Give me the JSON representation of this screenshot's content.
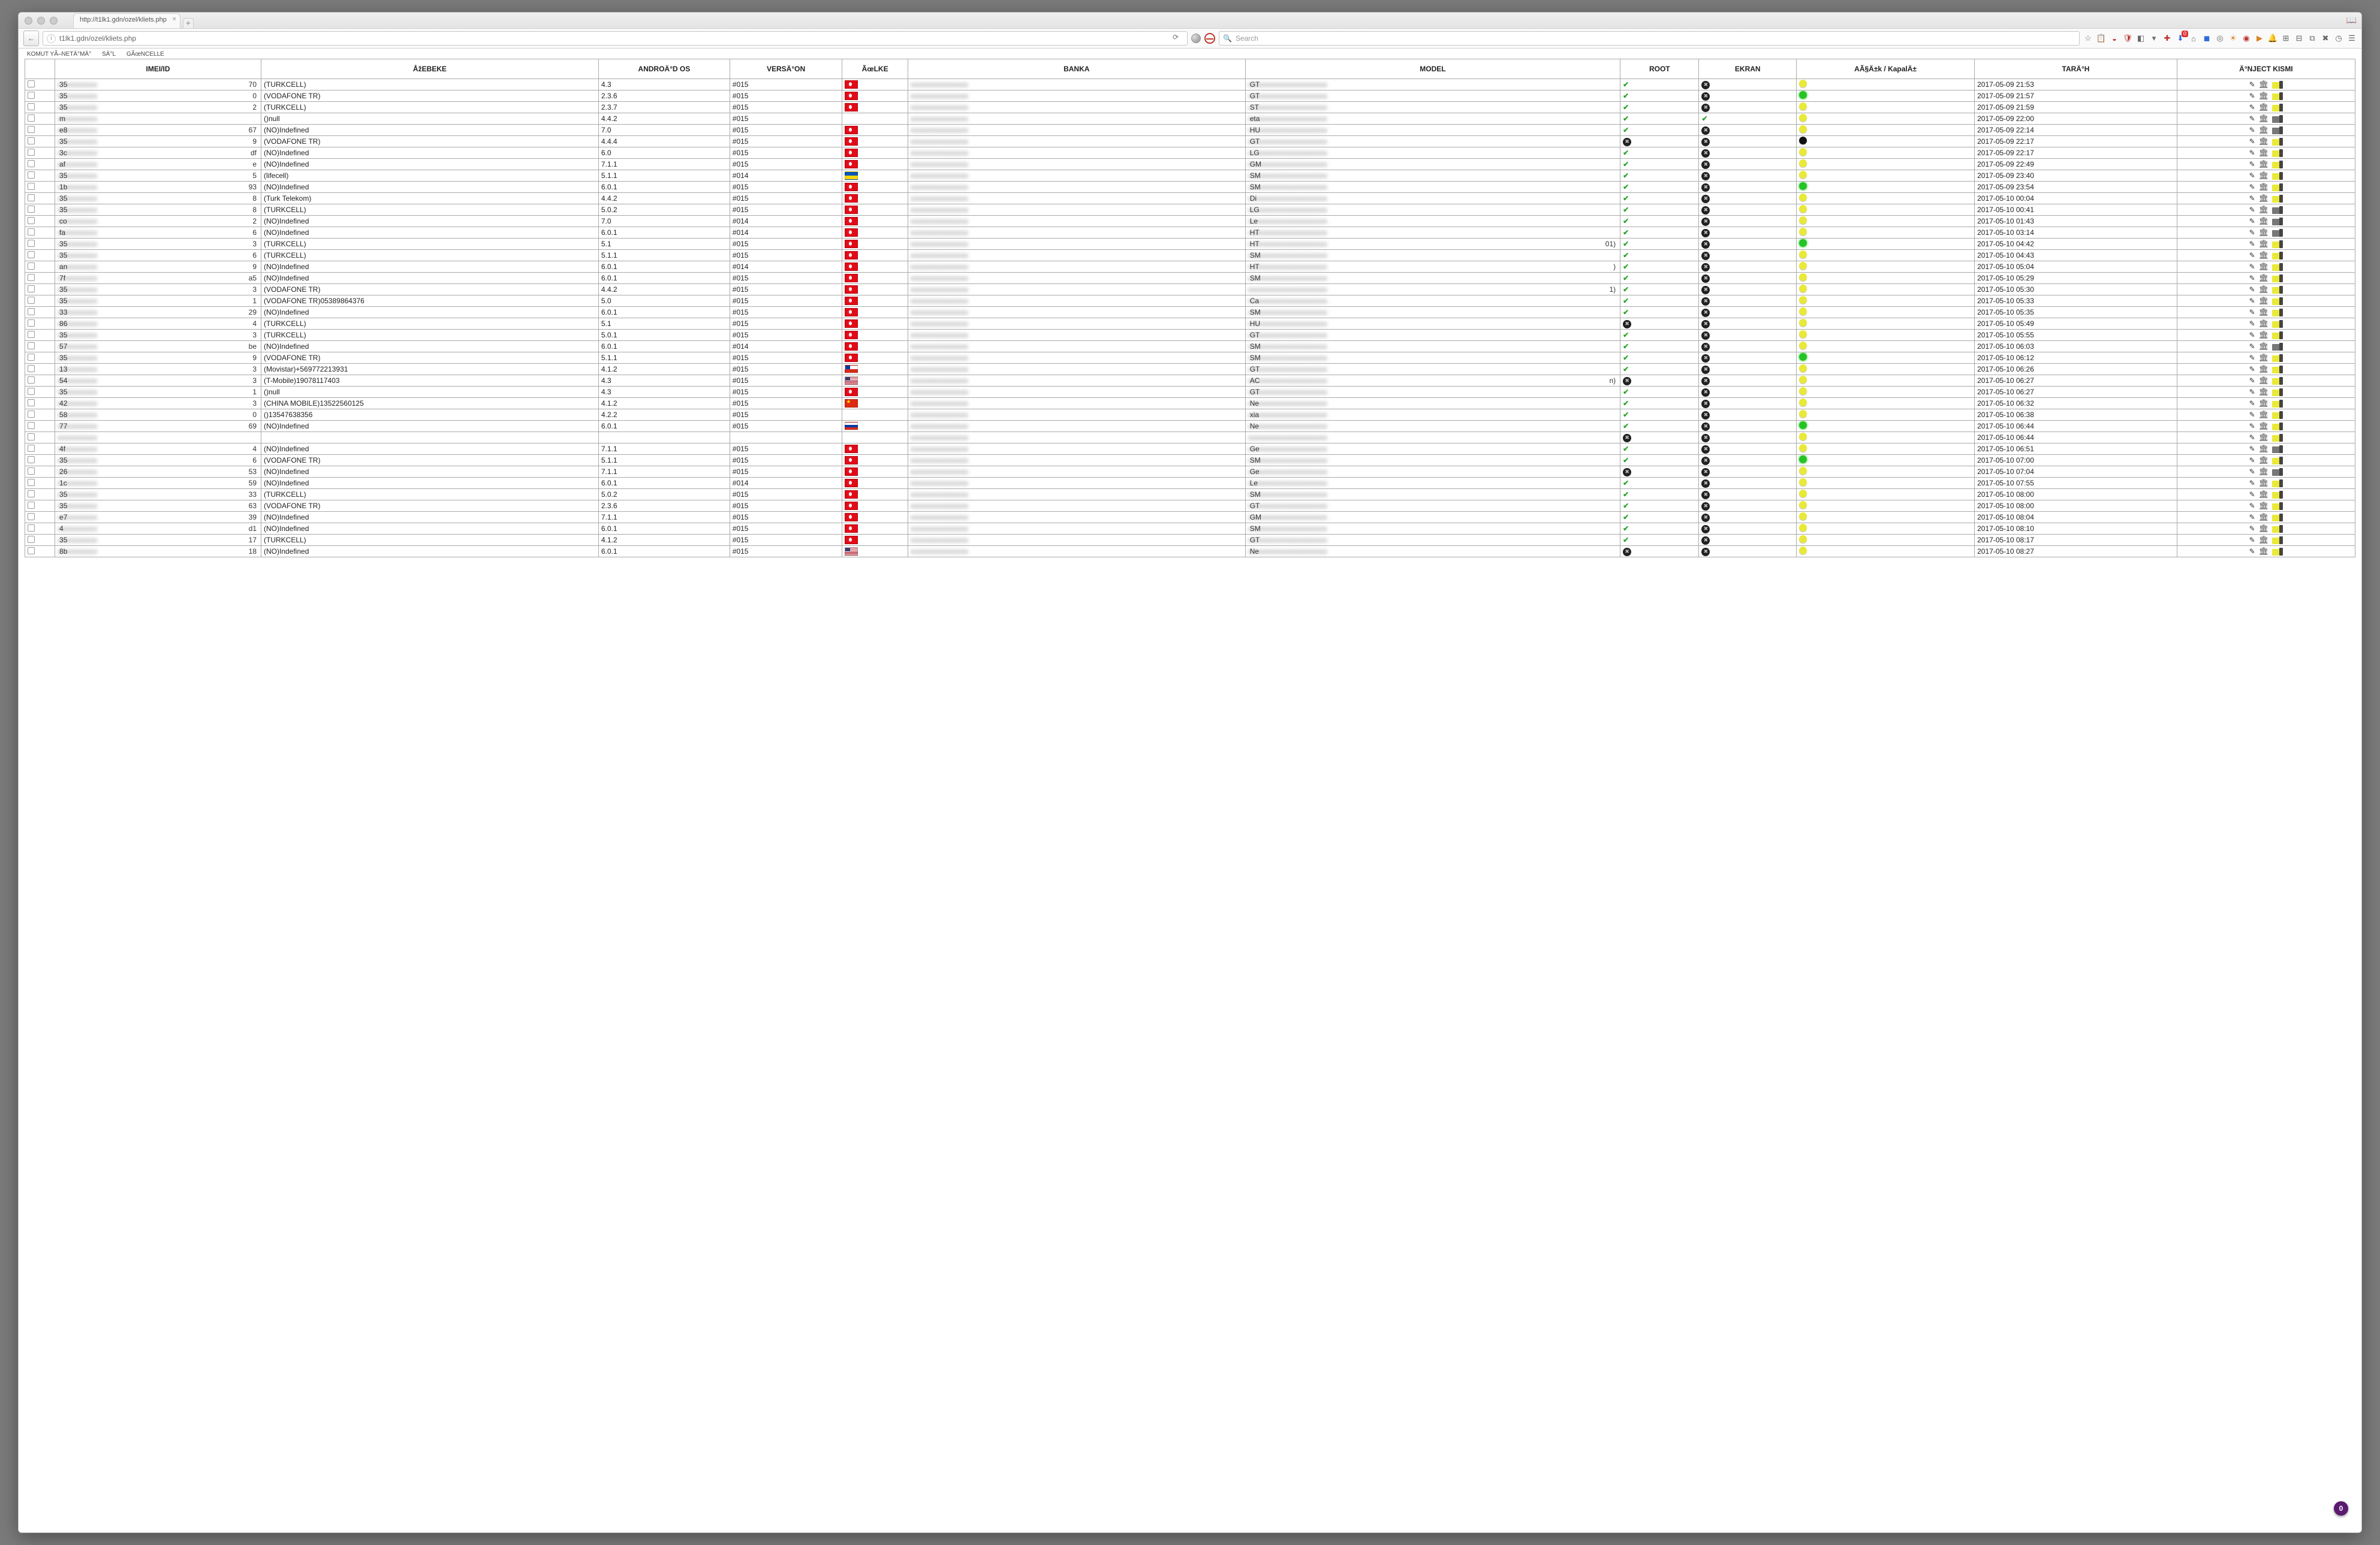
{
  "window": {
    "tab_title": "http://t1lk1.gdn/ozel/kliets.php",
    "sidebar_icon": "📖"
  },
  "toolbar": {
    "url": "t1lk1.gdn/ozel/kliets.php",
    "search_placeholder": "Search"
  },
  "page_menu": [
    "KOMUT YÃ–NETÄ°MÄ°",
    "SÄ°L",
    "GÃœNCELLE"
  ],
  "headers": {
    "imei": "IMEI/ID",
    "sebeke": "ÅžEBEKE",
    "android": "ANDROÄ°D OS",
    "version": "VERSÄ°ON",
    "ulke": "ÃœLKE",
    "banka": "BANKA",
    "model": "MODEL",
    "root": "ROOT",
    "ekran": "EKRAN",
    "acik": "AÃ§Ä±k / KapalÄ±",
    "tarih": "TARÄ°H",
    "inject": "Ä°NJECT KISMI"
  },
  "rows": [
    {
      "pre": "35",
      "suf": "70",
      "sebeke": "(TURKCELL)",
      "and": "4.3",
      "ver": "#015",
      "flag": "tr",
      "mpre": "GT",
      "root": "tick",
      "ekran": "x",
      "dot": "yel",
      "tarih": "2017-05-09 21:53",
      "fold": "yel"
    },
    {
      "pre": "35",
      "suf": "0",
      "sebeke": "(VODAFONE TR)",
      "and": "2.3.6",
      "ver": "#015",
      "flag": "tr",
      "mpre": "GT",
      "root": "tick",
      "ekran": "x",
      "dot": "grn",
      "tarih": "2017-05-09 21:57",
      "fold": "yel"
    },
    {
      "pre": "35",
      "suf": "2",
      "sebeke": "(TURKCELL)",
      "and": "2.3.7",
      "ver": "#015",
      "flag": "tr",
      "mpre": "ST",
      "root": "tick",
      "ekran": "x",
      "dot": "yel",
      "tarih": "2017-05-09 21:59",
      "fold": "yel"
    },
    {
      "pre": "m",
      "suf": "",
      "sebeke": "()null",
      "and": "4.4.2",
      "ver": "#015",
      "flag": "none",
      "mpre": "eta",
      "root": "tick",
      "ekran": "tick",
      "dot": "yel",
      "tarih": "2017-05-09 22:00",
      "fold": "gry"
    },
    {
      "pre": "e8",
      "suf": "67",
      "sebeke": "(NO)Indefined",
      "and": "7.0",
      "ver": "#015",
      "flag": "tr",
      "mpre": "HU",
      "root": "tick",
      "ekran": "x",
      "dot": "yel",
      "tarih": "2017-05-09 22:14",
      "fold": "gry"
    },
    {
      "pre": "35",
      "suf": "9",
      "sebeke": "(VODAFONE TR)",
      "and": "4.4.4",
      "ver": "#015",
      "flag": "tr",
      "mpre": "GT",
      "root": "x",
      "ekran": "x",
      "dot": "blk",
      "tarih": "2017-05-09 22:17",
      "fold": "yel"
    },
    {
      "pre": "3c",
      "suf": "df",
      "sebeke": "(NO)Indefined",
      "and": "6.0",
      "ver": "#015",
      "flag": "tr",
      "mpre": "LG",
      "root": "tick",
      "ekran": "x",
      "dot": "yel",
      "tarih": "2017-05-09 22:17",
      "fold": "yel"
    },
    {
      "pre": "af",
      "suf": "e",
      "sebeke": "(NO)Indefined",
      "and": "7.1.1",
      "ver": "#015",
      "flag": "tr",
      "mpre": "GM",
      "root": "tick",
      "ekran": "x",
      "dot": "yel",
      "tarih": "2017-05-09 22:49",
      "fold": "yel"
    },
    {
      "pre": "35",
      "suf": "5",
      "sebeke": "(lifecell)",
      "and": "5.1.1",
      "ver": "#014",
      "flag": "ua",
      "mpre": "SM",
      "root": "tick",
      "ekran": "x",
      "dot": "yel",
      "tarih": "2017-05-09 23:40",
      "fold": "yel"
    },
    {
      "pre": "1b",
      "suf": "93",
      "sebeke": "(NO)Indefined",
      "and": "6.0.1",
      "ver": "#015",
      "flag": "tr",
      "mpre": "SM",
      "root": "tick",
      "ekran": "x",
      "dot": "grn",
      "tarih": "2017-05-09 23:54",
      "fold": "yel"
    },
    {
      "pre": "35",
      "suf": "8",
      "sebeke": "(Turk Telekom)",
      "and": "4.4.2",
      "ver": "#015",
      "flag": "tr",
      "mpre": "Di",
      "root": "tick",
      "ekran": "x",
      "dot": "yel",
      "tarih": "2017-05-10 00:04",
      "fold": "yel"
    },
    {
      "pre": "35",
      "suf": "8",
      "sebeke": "(TURKCELL)",
      "and": "5.0.2",
      "ver": "#015",
      "flag": "tr",
      "mpre": "LG",
      "root": "tick",
      "ekran": "x",
      "dot": "yel",
      "tarih": "2017-05-10 00:41",
      "fold": "gry"
    },
    {
      "pre": "co",
      "suf": "2",
      "sebeke": "(NO)Indefined",
      "and": "7.0",
      "ver": "#014",
      "flag": "tr",
      "mpre": "Le",
      "root": "tick",
      "ekran": "x",
      "dot": "yel",
      "tarih": "2017-05-10 01:43",
      "fold": "gry"
    },
    {
      "pre": "fa",
      "suf": "6",
      "sebeke": "(NO)Indefined",
      "and": "6.0.1",
      "ver": "#014",
      "flag": "tr",
      "mpre": "HT",
      "root": "tick",
      "ekran": "x",
      "dot": "yel",
      "tarih": "2017-05-10 03:14",
      "fold": "gry"
    },
    {
      "pre": "35",
      "suf": "3",
      "sebeke": "(TURKCELL)",
      "and": "5.1",
      "ver": "#015",
      "flag": "tr",
      "mpre": "HT",
      "msuf": "01)",
      "root": "tick",
      "ekran": "x",
      "dot": "grn",
      "tarih": "2017-05-10 04:42",
      "fold": "yel"
    },
    {
      "pre": "35",
      "suf": "6",
      "sebeke": "(TURKCELL)",
      "and": "5.1.1",
      "ver": "#015",
      "flag": "tr",
      "mpre": "SM",
      "root": "tick",
      "ekran": "x",
      "dot": "yel",
      "tarih": "2017-05-10 04:43",
      "fold": "yel"
    },
    {
      "pre": "an",
      "suf": "9",
      "sebeke": "(NO)Indefined",
      "and": "6.0.1",
      "ver": "#014",
      "flag": "tr",
      "mpre": "HT",
      "msuf": ")",
      "root": "tick",
      "ekran": "x",
      "dot": "yel",
      "tarih": "2017-05-10 05:04",
      "fold": "yel"
    },
    {
      "pre": "7f",
      "suf": "a5",
      "sebeke": "(NO)Indefined",
      "and": "6.0.1",
      "ver": "#015",
      "flag": "tr",
      "mpre": "SM",
      "root": "tick",
      "ekran": "x",
      "dot": "yel",
      "tarih": "2017-05-10 05:29",
      "fold": "yel"
    },
    {
      "pre": "35",
      "suf": "3",
      "sebeke": "(VODAFONE TR)",
      "and": "4.4.2",
      "ver": "#015",
      "flag": "tr",
      "mpre": "",
      "msuf": "1)",
      "root": "tick",
      "ekran": "x",
      "dot": "yel",
      "tarih": "2017-05-10 05:30",
      "fold": "yel"
    },
    {
      "pre": "35",
      "suf": "1",
      "sebeke": "(VODAFONE TR)05389864376",
      "and": "5.0",
      "ver": "#015",
      "flag": "tr",
      "mpre": "Ca",
      "root": "tick",
      "ekran": "x",
      "dot": "yel",
      "tarih": "2017-05-10 05:33",
      "fold": "yel"
    },
    {
      "pre": "33",
      "suf": "29",
      "sebeke": "(NO)Indefined",
      "and": "6.0.1",
      "ver": "#015",
      "flag": "tr",
      "mpre": "SM",
      "root": "tick",
      "ekran": "x",
      "dot": "yel",
      "tarih": "2017-05-10 05:35",
      "fold": "yel"
    },
    {
      "pre": "86",
      "suf": "4",
      "sebeke": "(TURKCELL)",
      "and": "5.1",
      "ver": "#015",
      "flag": "tr",
      "mpre": "HU",
      "root": "x",
      "ekran": "x",
      "dot": "yel",
      "tarih": "2017-05-10 05:49",
      "fold": "yel"
    },
    {
      "pre": "35",
      "suf": "3",
      "sebeke": "(TURKCELL)",
      "and": "5.0.1",
      "ver": "#015",
      "flag": "tr",
      "mpre": "GT",
      "root": "tick",
      "ekran": "x",
      "dot": "yel",
      "tarih": "2017-05-10 05:55",
      "fold": "yel"
    },
    {
      "pre": "57",
      "suf": "be",
      "sebeke": "(NO)Indefined",
      "and": "6.0.1",
      "ver": "#014",
      "flag": "tr",
      "mpre": "SM",
      "root": "tick",
      "ekran": "x",
      "dot": "yel",
      "tarih": "2017-05-10 06:03",
      "fold": "gry"
    },
    {
      "pre": "35",
      "suf": "9",
      "sebeke": "(VODAFONE TR)",
      "and": "5.1.1",
      "ver": "#015",
      "flag": "tr",
      "mpre": "SM",
      "root": "tick",
      "ekran": "x",
      "dot": "grn",
      "tarih": "2017-05-10 06:12",
      "fold": "yel"
    },
    {
      "pre": "13",
      "suf": "3",
      "sebeke": "(Movistar)+569772213931",
      "and": "4.1.2",
      "ver": "#015",
      "flag": "cl",
      "mpre": "GT",
      "root": "tick",
      "ekran": "x",
      "dot": "yel",
      "tarih": "2017-05-10 06:26",
      "fold": "yel"
    },
    {
      "pre": "54",
      "suf": "3",
      "sebeke": "(T-Mobile)19078117403",
      "and": "4.3",
      "ver": "#015",
      "flag": "us",
      "mpre": "AC",
      "msuf": "n)",
      "root": "x",
      "ekran": "x",
      "dot": "yel",
      "tarih": "2017-05-10 06:27",
      "fold": "yel"
    },
    {
      "pre": "35",
      "suf": "1",
      "sebeke": "()null",
      "and": "4.3",
      "ver": "#015",
      "flag": "tr",
      "mpre": "GT",
      "root": "tick",
      "ekran": "x",
      "dot": "yel",
      "tarih": "2017-05-10 06:27",
      "fold": "yel"
    },
    {
      "pre": "42",
      "suf": "3",
      "sebeke": "(CHINA MOBILE)13522560125",
      "and": "4.1.2",
      "ver": "#015",
      "flag": "cn",
      "mpre": "Ne",
      "root": "tick",
      "ekran": "x",
      "dot": "yel",
      "tarih": "2017-05-10 06:32",
      "fold": "yel"
    },
    {
      "pre": "58",
      "suf": "0",
      "sebeke": "()13547638356",
      "and": "4.2.2",
      "ver": "#015",
      "flag": "none",
      "mpre": "xia",
      "root": "tick",
      "ekran": "x",
      "dot": "yel",
      "tarih": "2017-05-10 06:38",
      "fold": "yel"
    },
    {
      "pre": "77",
      "suf": "69",
      "sebeke": "(NO)Indefined",
      "and": "6.0.1",
      "ver": "#015",
      "flag": "ru",
      "mpre": "Ne",
      "root": "tick",
      "ekran": "x",
      "dot": "grn",
      "tarih": "2017-05-10 06:44",
      "fold": "yel"
    },
    {
      "pre": "",
      "suf": "",
      "sebeke": "",
      "and": "",
      "ver": "",
      "flag": "none",
      "mpre": "",
      "root": "x",
      "ekran": "x",
      "dot": "yel",
      "tarih": "2017-05-10 06:44",
      "fold": "yel"
    },
    {
      "pre": "4f",
      "suf": "4",
      "sebeke": "(NO)Indefined",
      "and": "7.1.1",
      "ver": "#015",
      "flag": "tr",
      "mpre": "Ge",
      "root": "tick",
      "ekran": "x",
      "dot": "yel",
      "tarih": "2017-05-10 06:51",
      "fold": "gry"
    },
    {
      "pre": "35",
      "suf": "6",
      "sebeke": "(VODAFONE TR)",
      "and": "5.1.1",
      "ver": "#015",
      "flag": "tr",
      "mpre": "SM",
      "root": "tick",
      "ekran": "x",
      "dot": "grn",
      "tarih": "2017-05-10 07:00",
      "fold": "yel"
    },
    {
      "pre": "26",
      "suf": "53",
      "sebeke": "(NO)Indefined",
      "and": "7.1.1",
      "ver": "#015",
      "flag": "tr",
      "mpre": "Ge",
      "root": "x",
      "ekran": "x",
      "dot": "yel",
      "tarih": "2017-05-10 07:04",
      "fold": "gry"
    },
    {
      "pre": "1c",
      "suf": "59",
      "sebeke": "(NO)Indefined",
      "and": "6.0.1",
      "ver": "#014",
      "flag": "tr",
      "mpre": "Le",
      "root": "tick",
      "ekran": "x",
      "dot": "yel",
      "tarih": "2017-05-10 07:55",
      "fold": "yel"
    },
    {
      "pre": "35",
      "suf": "33",
      "sebeke": "(TURKCELL)",
      "and": "5.0.2",
      "ver": "#015",
      "flag": "tr",
      "mpre": "SM",
      "root": "tick",
      "ekran": "x",
      "dot": "yel",
      "tarih": "2017-05-10 08:00",
      "fold": "yel"
    },
    {
      "pre": "35",
      "suf": "63",
      "sebeke": "(VODAFONE TR)",
      "and": "2.3.6",
      "ver": "#015",
      "flag": "tr",
      "mpre": "GT",
      "root": "tick",
      "ekran": "x",
      "dot": "yel",
      "tarih": "2017-05-10 08:00",
      "fold": "yel"
    },
    {
      "pre": "e7",
      "suf": "39",
      "sebeke": "(NO)Indefined",
      "and": "7.1.1",
      "ver": "#015",
      "flag": "tr",
      "mpre": "GM",
      "root": "tick",
      "ekran": "x",
      "dot": "yel",
      "tarih": "2017-05-10 08:04",
      "fold": "yel"
    },
    {
      "pre": "4",
      "suf": "d1",
      "sebeke": "(NO)Indefined",
      "and": "6.0.1",
      "ver": "#015",
      "flag": "tr",
      "mpre": "SM",
      "root": "tick",
      "ekran": "x",
      "dot": "yel",
      "tarih": "2017-05-10 08:10",
      "fold": "yel"
    },
    {
      "pre": "35",
      "suf": "17",
      "sebeke": "(TURKCELL)",
      "and": "4.1.2",
      "ver": "#015",
      "flag": "tr",
      "mpre": "GT",
      "root": "tick",
      "ekran": "x",
      "dot": "yel",
      "tarih": "2017-05-10 08:17",
      "fold": "yel"
    },
    {
      "pre": "8b",
      "suf": "18",
      "sebeke": "(NO)Indefined",
      "and": "6.0.1",
      "ver": "#015",
      "flag": "us",
      "mpre": "Ne",
      "root": "x",
      "ekran": "x",
      "dot": "yel",
      "tarih": "2017-05-10 08:27",
      "fold": "yel"
    }
  ],
  "counter": "0"
}
